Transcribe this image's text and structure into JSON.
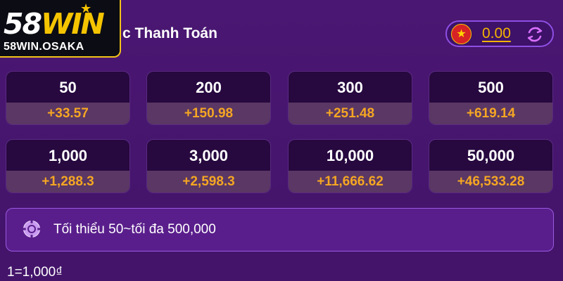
{
  "logo": {
    "text_58": "58",
    "text_win": "WIN",
    "sub": "58WIN.OSAKA"
  },
  "header": {
    "title": "c Thanh Toán",
    "balance": "0.00"
  },
  "amounts": [
    {
      "amount": "50",
      "bonus": "+33.57"
    },
    {
      "amount": "200",
      "bonus": "+150.98"
    },
    {
      "amount": "300",
      "bonus": "+251.48"
    },
    {
      "amount": "500",
      "bonus": "+619.14"
    },
    {
      "amount": "1,000",
      "bonus": "+1,288.3"
    },
    {
      "amount": "3,000",
      "bonus": "+2,598.3"
    },
    {
      "amount": "10,000",
      "bonus": "+11,666.62"
    },
    {
      "amount": "50,000",
      "bonus": "+46,533.28"
    }
  ],
  "info": {
    "limit_text": "Tối thiểu 50~tối đa 500,000",
    "icon": "chip-icon"
  },
  "rate": "1=1,000₫",
  "colors": {
    "background": "#4a1772",
    "accent": "#f5b400",
    "bonus": "#f5a623",
    "card": "#27083f",
    "card_bonus_bg": "#5a3764"
  }
}
